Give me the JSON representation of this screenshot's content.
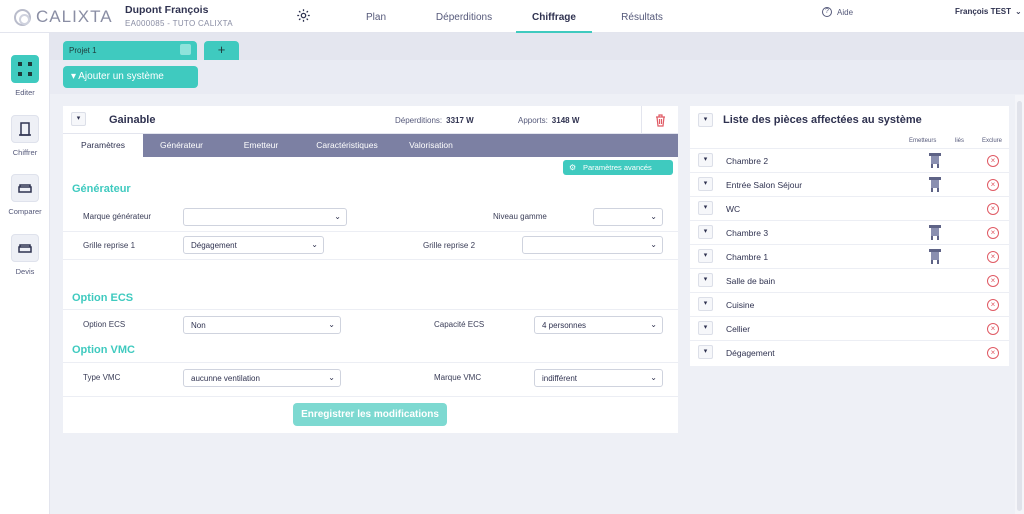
{
  "app": {
    "logo_text": "CALIXTA"
  },
  "client": {
    "name": "Dupont François",
    "reference": "EA000085 - TUTO CALIXTA"
  },
  "nav": {
    "items": [
      "Plan",
      "Déperditions",
      "Chiffrage",
      "Résultats"
    ],
    "active": "Chiffrage"
  },
  "header": {
    "help_label": "Aide",
    "user_name": "François TEST"
  },
  "sidebar": {
    "items": [
      "Editer",
      "Chiffrer",
      "Comparer",
      "Devis"
    ],
    "active": "Editer"
  },
  "project": {
    "tab_label": "Projet 1",
    "add_tab_label": "+"
  },
  "toolbar": {
    "add_system_label": "Ajouter un système"
  },
  "system": {
    "title": "Gainable",
    "losses_label": "Déperditions:",
    "losses_value": "3317 W",
    "gains_label": "Apports:",
    "gains_value": "3148 W",
    "tabs": [
      "Paramètres",
      "Générateur",
      "Emetteur",
      "Caractéristiques",
      "Valorisation"
    ],
    "active_tab": "Paramètres",
    "advanced_label": "Paramètres avancés",
    "sections": {
      "generator": {
        "title": "Générateur",
        "brand_label": "Marque générateur",
        "brand_value": "",
        "range_label": "Niveau gamme",
        "range_value": "",
        "grille1_label": "Grille reprise 1",
        "grille1_value": "Dégagement",
        "grille2_label": "Grille reprise 2",
        "grille2_value": ""
      },
      "ecs": {
        "title": "Option ECS",
        "option_label": "Option ECS",
        "option_value": "Non",
        "capacity_label": "Capacité ECS",
        "capacity_value": "4 personnes"
      },
      "vmc": {
        "title": "Option VMC",
        "type_label": "Type VMC",
        "type_value": "aucunne ventilation",
        "brand_label": "Marque VMC",
        "brand_value": "indifférent"
      }
    },
    "save_label": "Enregistrer les modifications"
  },
  "rooms": {
    "title": "Liste des pièces affectées au système",
    "columns": {
      "emitters": "Emetteurs",
      "linked": "liés",
      "exclude": "Exclure"
    },
    "items": [
      {
        "name": "Chambre 2",
        "has_emitter": true
      },
      {
        "name": "Entrée Salon Séjour",
        "has_emitter": true
      },
      {
        "name": "WC",
        "has_emitter": false
      },
      {
        "name": "Chambre 3",
        "has_emitter": true
      },
      {
        "name": "Chambre 1",
        "has_emitter": true
      },
      {
        "name": "Salle de bain",
        "has_emitter": false
      },
      {
        "name": "Cuisine",
        "has_emitter": false
      },
      {
        "name": "Cellier",
        "has_emitter": false
      },
      {
        "name": "Dégagement",
        "has_emitter": false
      }
    ]
  },
  "colors": {
    "accent": "#3fcabf",
    "tabbar": "#7c80a3",
    "danger": "#e05a64"
  },
  "icons": {
    "gear": "gear-icon",
    "help": "help-icon",
    "edit": "edit-icon",
    "trash": "trash-icon",
    "exclude": "exclude-icon",
    "emitter": "emitter-icon",
    "caret": "caret-down-icon"
  }
}
